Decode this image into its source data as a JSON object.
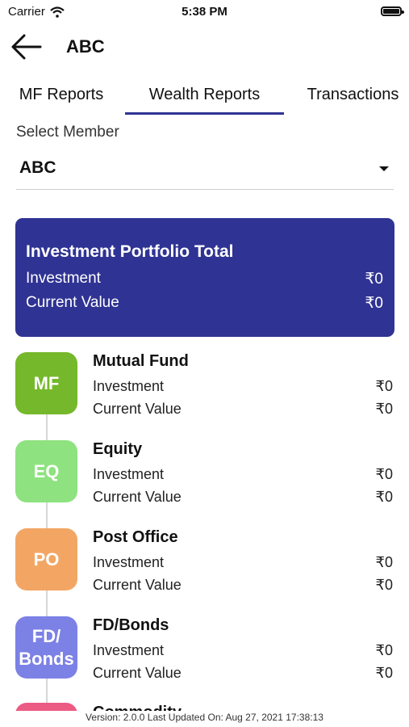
{
  "status": {
    "carrier": "Carrier",
    "time": "5:38 PM"
  },
  "header": {
    "title": "ABC"
  },
  "tabs": [
    {
      "label": "MF Reports"
    },
    {
      "label": "Wealth Reports",
      "active": true
    },
    {
      "label": "Transactions"
    }
  ],
  "member": {
    "label": "Select Member",
    "value": "ABC"
  },
  "portfolio": {
    "title": "Investment Portfolio Total",
    "investment_label": "Investment",
    "investment_value": "₹0",
    "current_label": "Current Value",
    "current_value": "₹0"
  },
  "assets": [
    {
      "badge": "MF",
      "name": "Mutual Fund",
      "investment_label": "Investment",
      "investment_value": "₹0",
      "current_label": "Current Value",
      "current_value": "₹0",
      "color": "#75b82b"
    },
    {
      "badge": "EQ",
      "name": "Equity",
      "investment_label": "Investment",
      "investment_value": "₹0",
      "current_label": "Current Value",
      "current_value": "₹0",
      "color": "#8ee27f"
    },
    {
      "badge": "PO",
      "name": "Post Office",
      "investment_label": "Investment",
      "investment_value": "₹0",
      "current_label": "Current Value",
      "current_value": "₹0",
      "color": "#f3a664"
    },
    {
      "badge": "FD/\nBonds",
      "name": "FD/Bonds",
      "investment_label": "Investment",
      "investment_value": "₹0",
      "current_label": "Current Value",
      "current_value": "₹0",
      "color": "#7c81e6"
    }
  ],
  "partial_asset": {
    "name": "Commodity",
    "color": "#ec5b83"
  },
  "footer": {
    "text": "Version: 2.0.0 Last Updated On: Aug 27, 2021 17:38:13"
  },
  "colors": {
    "primary": "#2f3393"
  }
}
